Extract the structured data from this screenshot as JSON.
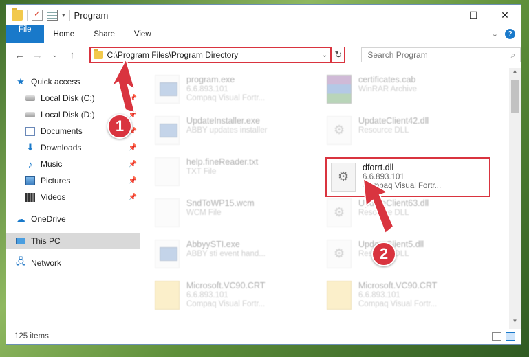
{
  "window": {
    "title": "Program",
    "controls": {
      "minimize": "—",
      "maximize": "☐",
      "close": "✕"
    }
  },
  "ribbon": {
    "tabs": [
      "File",
      "Home",
      "Share",
      "View"
    ],
    "expand_icon": "chevron-down-icon",
    "help": "?"
  },
  "nav": {
    "back": "←",
    "forward": "→",
    "recent": "⌄",
    "up": "↑",
    "address": "C:\\Program Files\\Program Directory",
    "address_dropdown": "⌄",
    "refresh": "↻",
    "search_placeholder": "Search Program",
    "search_icon": "⌕"
  },
  "sidebar": {
    "quick_access": "Quick access",
    "items": [
      {
        "label": "Local Disk (C:)",
        "icon": "disk-icon"
      },
      {
        "label": "Local Disk (D:)",
        "icon": "disk-icon"
      },
      {
        "label": "Documents",
        "icon": "documents-icon"
      },
      {
        "label": "Downloads",
        "icon": "downloads-icon"
      },
      {
        "label": "Music",
        "icon": "music-icon"
      },
      {
        "label": "Pictures",
        "icon": "pictures-icon"
      },
      {
        "label": "Videos",
        "icon": "videos-icon"
      }
    ],
    "onedrive": "OneDrive",
    "this_pc": "This PC",
    "network": "Network"
  },
  "files": [
    {
      "name": "program.exe",
      "line2": "6.6.893.101",
      "line3": "Compaq Visual Fortr...",
      "type": "exe"
    },
    {
      "name": "certificates.cab",
      "line2": "WinRAR Archive",
      "line3": "",
      "type": "rar"
    },
    {
      "name": "UpdateInstaller.exe",
      "line2": "ABBY updates installer",
      "line3": "",
      "type": "exe"
    },
    {
      "name": "UpdateClient42.dll",
      "line2": "Resource DLL",
      "line3": "",
      "type": "dll"
    },
    {
      "name": "help.fineReader.txt",
      "line2": "TXT File",
      "line3": "",
      "type": "txt"
    },
    {
      "name": "dforrt.dll",
      "line2": "6.6.893.101",
      "line3": "Compaq Visual Fortr...",
      "type": "dll"
    },
    {
      "name": "SndToWP15.wcm",
      "line2": "WCM File",
      "line3": "",
      "type": "txt"
    },
    {
      "name": "UpdateClient63.dll",
      "line2": "Resource DLL",
      "line3": "",
      "type": "dll"
    },
    {
      "name": "AbbyySTI.exe",
      "line2": "ABBY sti event hand...",
      "line3": "",
      "type": "exe"
    },
    {
      "name": "UpdateClient5.dll",
      "line2": "Resource DLL",
      "line3": "",
      "type": "dll"
    },
    {
      "name": "Microsoft.VC90.CRT",
      "line2": "6.6.893.101",
      "line3": "Compaq Visual Fortr...",
      "type": "zip"
    },
    {
      "name": "Microsoft.VC90.CRT",
      "line2": "6.6.893.101",
      "line3": "Compaq Visual Fortr...",
      "type": "zip"
    }
  ],
  "status": {
    "count": "125 items"
  },
  "annotations": {
    "step1": "1",
    "step2": "2"
  },
  "colors": {
    "accent": "#1979ca",
    "highlight": "#d9343f"
  }
}
